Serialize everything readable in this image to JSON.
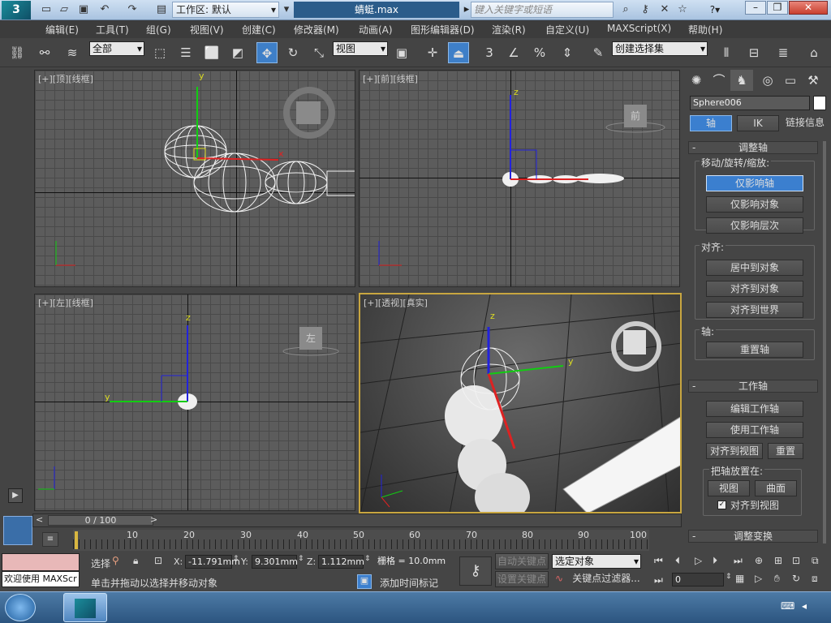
{
  "titlebar": {
    "workspace": "工作区: 默认",
    "filename": "蜻蜓.max",
    "search_placeholder": "键入关键字或短语",
    "help": "?"
  },
  "menu": [
    "编辑(E)",
    "工具(T)",
    "组(G)",
    "视图(V)",
    "创建(C)",
    "修改器(M)",
    "动画(A)",
    "图形编辑器(D)",
    "渲染(R)",
    "自定义(U)",
    "MAXScript(X)",
    "帮助(H)"
  ],
  "toolbar": {
    "selection_filter": "全部",
    "ref_coord": "视图",
    "named_selection": "创建选择集",
    "snap3": "3",
    "snap_pct": "%"
  },
  "viewports": {
    "top": {
      "label": "[+][顶][线框]",
      "axis_y": "y",
      "axis_x": "x"
    },
    "front": {
      "label": "[+][前][线框]",
      "axis_z": "z",
      "cube": "前"
    },
    "left": {
      "label": "[+][左][线框]",
      "axis_z": "z",
      "axis_y": "y",
      "cube": "左"
    },
    "persp": {
      "label": "[+][透视][真实]",
      "axis_z": "z",
      "axis_y": "y"
    }
  },
  "panel": {
    "object_name": "Sphere006",
    "tabs": [
      "轴",
      "IK",
      "链接信息"
    ],
    "adjust_pivot": "调整轴",
    "move_rotate_scale": "移动/旋转/缩放:",
    "affect_pivot_only": "仅影响轴",
    "affect_object_only": "仅影响对象",
    "affect_hierarchy_only": "仅影响层次",
    "align": "对齐:",
    "center_to_object": "居中到对象",
    "align_to_object": "对齐到对象",
    "align_to_world": "对齐到世界",
    "pivot": "轴:",
    "reset_pivot": "重置轴",
    "working_pivot": "工作轴",
    "edit_working_pivot": "编辑工作轴",
    "use_working_pivot": "使用工作轴",
    "align_to_view": "对齐到视图",
    "reset": "重置",
    "place_pivot_to": "把轴放置在:",
    "view": "视图",
    "surface": "曲面",
    "align_to_view_check": "对齐到视图",
    "adjust_transform": "调整变换"
  },
  "timeline": {
    "frame": "0 / 100",
    "ticks": [
      "10",
      "20",
      "30",
      "40",
      "50",
      "60",
      "70",
      "80",
      "90",
      "100"
    ]
  },
  "status": {
    "welcome": "欢迎使用 MAXScr",
    "selected": "选择",
    "x_label": "X:",
    "x": "-11.791mm",
    "y_label": "Y:",
    "y": "9.301mm",
    "z_label": "Z:",
    "z": "1.112mm",
    "grid": "栅格 = 10.0mm",
    "prompt": "单击并拖动以选择并移动对象",
    "add_time_tag": "添加时间标记",
    "auto_key": "自动关键点",
    "set_key": "设置关键点",
    "key_mode": "选定对象",
    "key_filters": "关键点过滤器...",
    "frame_field": "0"
  },
  "colors": {
    "accent": "#2f7fd6",
    "axis_x": "#d22",
    "axis_y": "#2c2",
    "axis_z": "#22d"
  }
}
